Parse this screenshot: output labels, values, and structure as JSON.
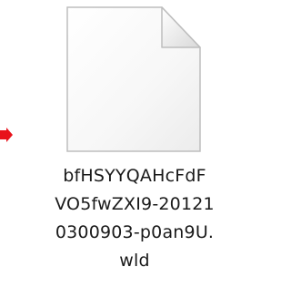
{
  "file": {
    "icon": "blank-document-icon",
    "name_lines": [
      "bfHSYYQAHcFdF",
      "VO5fwZXI9-20121",
      "0300903-p0an9U.",
      "wld"
    ]
  },
  "pointer": {
    "icon": "red-arrow-icon",
    "color": "#e8121b"
  }
}
